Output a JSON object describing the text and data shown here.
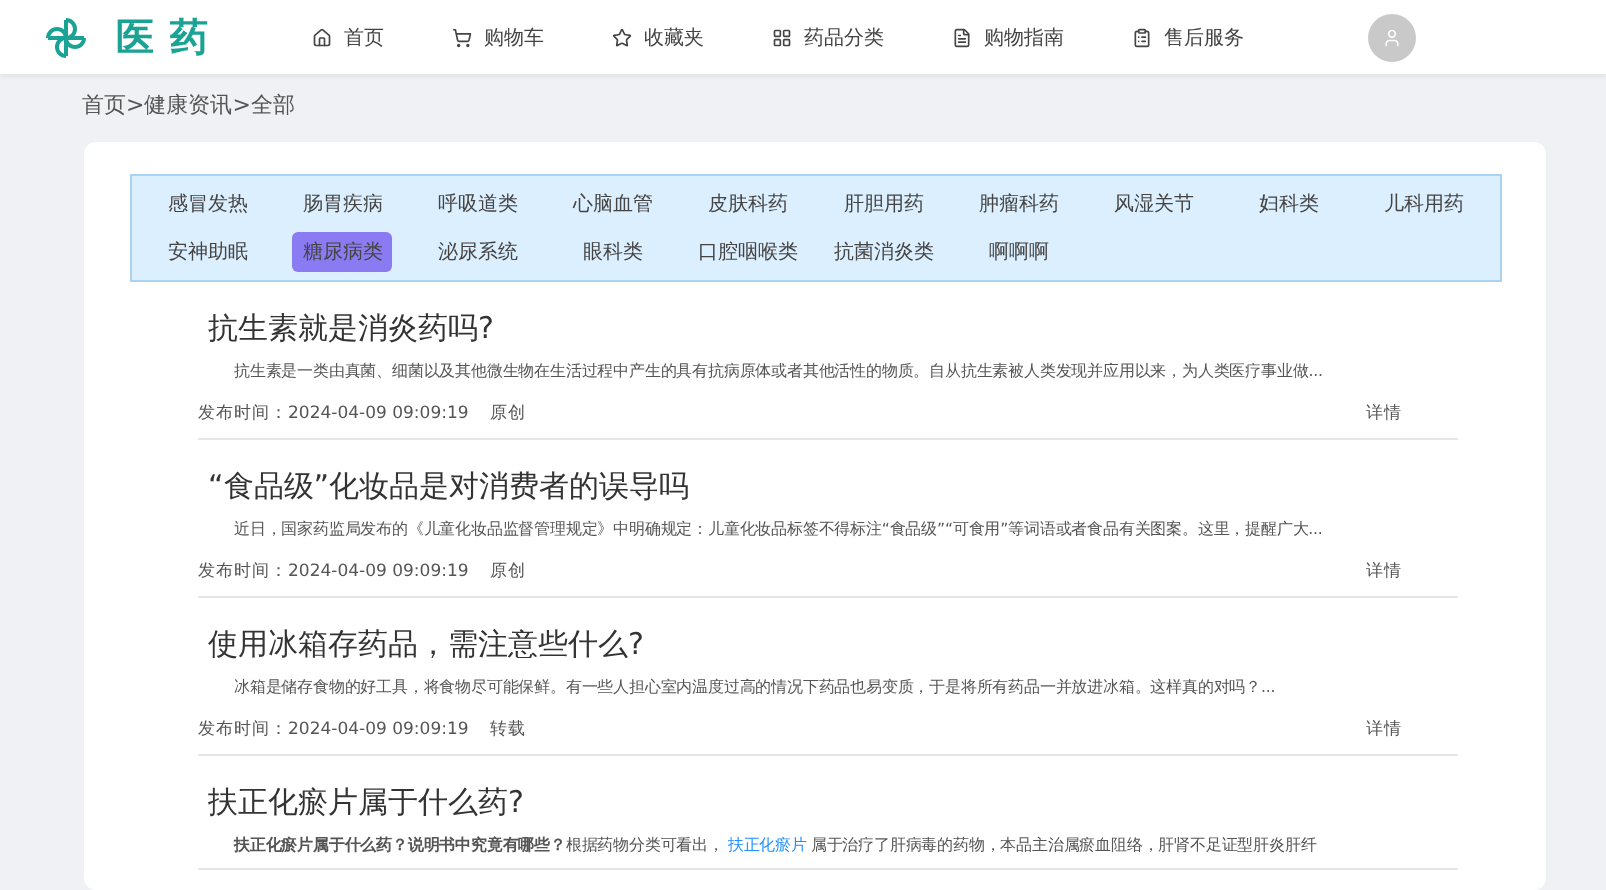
{
  "logo": {
    "text": "医药"
  },
  "nav": [
    {
      "label": "首页",
      "kind": "home"
    },
    {
      "label": "购物车",
      "kind": "cart"
    },
    {
      "label": "收藏夹",
      "kind": "star"
    },
    {
      "label": "药品分类",
      "kind": "grid"
    },
    {
      "label": "购物指南",
      "kind": "doc"
    },
    {
      "label": "售后服务",
      "kind": "service"
    }
  ],
  "breadcrumb": "首页>健康资讯>全部",
  "categories": [
    {
      "label": "感冒发热",
      "selected": false
    },
    {
      "label": "肠胃疾病",
      "selected": false
    },
    {
      "label": "呼吸道类",
      "selected": false
    },
    {
      "label": "心脑血管",
      "selected": false
    },
    {
      "label": "皮肤科药",
      "selected": false
    },
    {
      "label": "肝胆用药",
      "selected": false
    },
    {
      "label": "肿瘤科药",
      "selected": false
    },
    {
      "label": "风湿关节",
      "selected": false
    },
    {
      "label": "妇科类",
      "selected": false
    },
    {
      "label": "儿科用药",
      "selected": false
    },
    {
      "label": "安神助眠",
      "selected": false
    },
    {
      "label": "糖尿病类",
      "selected": true
    },
    {
      "label": "泌尿系统",
      "selected": false
    },
    {
      "label": "眼科类",
      "selected": false
    },
    {
      "label": "口腔咽喉类",
      "selected": false
    },
    {
      "label": "抗菌消炎类",
      "selected": false
    },
    {
      "label": "啊啊啊",
      "selected": false
    }
  ],
  "articles": [
    {
      "title": "抗生素就是消炎药吗?",
      "excerpt": "抗生素是一类由真菌、细菌以及其他微生物在生活过程中产生的具有抗病原体或者其他活性的物质。自从抗生素被人类发现并应用以来，为人类医疗事业做...",
      "time": "发布时间：2024-04-09 09:09:19",
      "source": "原创",
      "detail": "详情"
    },
    {
      "title": "“食品级”化妆品是对消费者的误导吗",
      "excerpt": "近日，国家药监局发布的《儿童化妆品监督管理规定》中明确规定：儿童化妆品标签不得标注“食品级”“可食用”等词语或者食品有关图案。这里，提醒广大...",
      "time": "发布时间：2024-04-09 09:09:19",
      "source": "原创",
      "detail": "详情"
    },
    {
      "title": "使用冰箱存药品，需注意些什么?",
      "excerpt": "冰箱是储存食物的好工具，将食物尽可能保鲜。有一些人担心室内温度过高的情况下药品也易变质，于是将所有药品一并放进冰箱。这样真的对吗？...",
      "time": "发布时间：2024-04-09 09:09:19",
      "source": "转载",
      "detail": "详情"
    },
    {
      "title": "扶正化瘀片属于什么药?",
      "excerpt_parts": [
        {
          "kind": "text",
          "text": "**扶正化瘀片属于什么药？说明书中究竟有哪些？**根据药物分类可看出，"
        },
        {
          "kind": "link",
          "text": "扶正化瘀片"
        },
        {
          "kind": "text",
          "text": "属于治疗了肝病毒的药物，本品主治属瘀血阻络，肝肾不足证型肝炎肝纤"
        }
      ]
    }
  ]
}
